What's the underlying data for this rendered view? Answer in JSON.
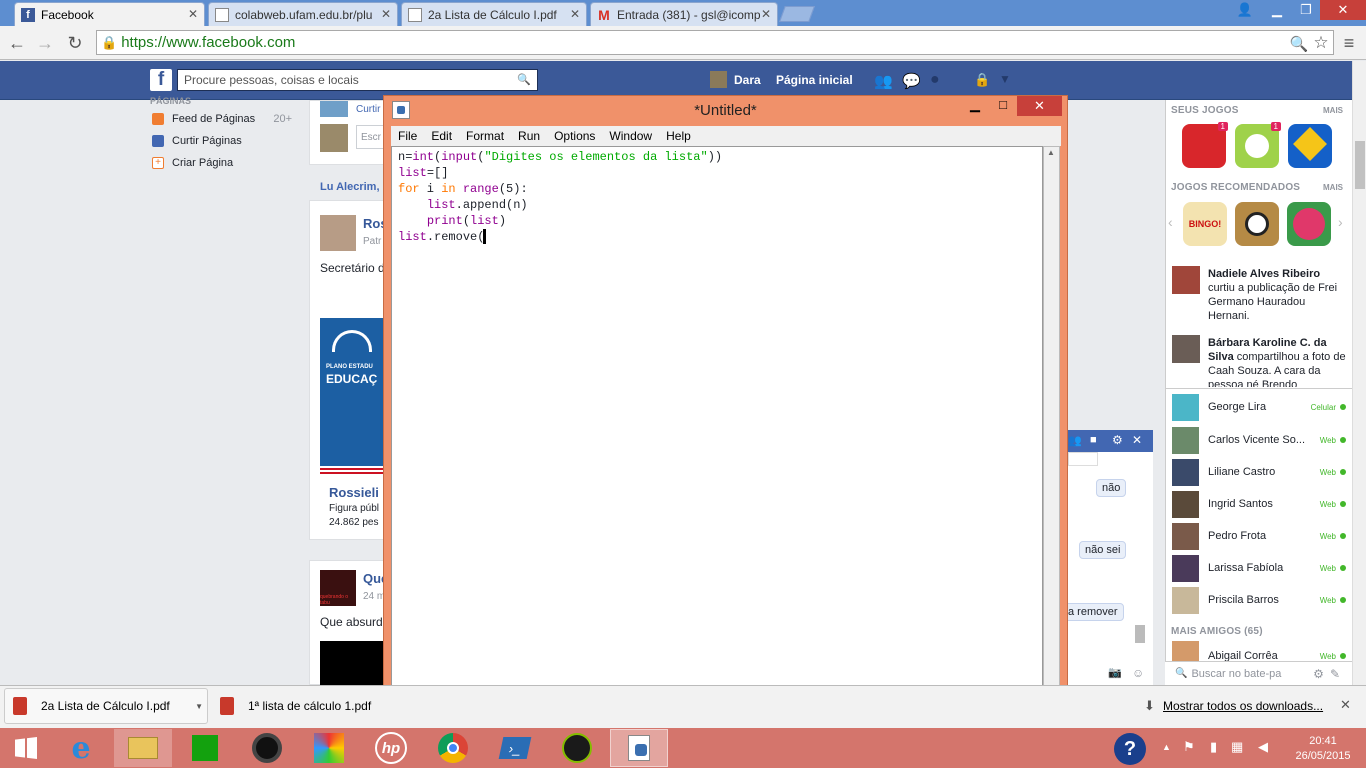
{
  "browser": {
    "tabs": [
      {
        "label": "Facebook",
        "icon": "facebook-icon"
      },
      {
        "label": "colabweb.ufam.edu.br/plu",
        "icon": "page-icon"
      },
      {
        "label": "2a Lista de Cálculo I.pdf",
        "icon": "page-icon"
      },
      {
        "label": "Entrada (381) - gsl@icomp",
        "icon": "gmail-icon"
      }
    ],
    "url": "https://www.facebook.com"
  },
  "facebook": {
    "search_placeholder": "Procure pessoas, coisas e locais",
    "user_name": "Dara",
    "home_label": "Página inicial",
    "left_nav": {
      "section": "PÁGINAS",
      "items": [
        {
          "label": "Feed de Páginas",
          "count": "20+"
        },
        {
          "label": "Curtir Páginas"
        },
        {
          "label": "Criar Página"
        }
      ]
    },
    "feed": {
      "curtir": "Curtir",
      "escrever": "Escr",
      "post_author_partial": "Lu Alecrim,",
      "post1": {
        "name": "Ros",
        "sub": "Patr",
        "text": "Secretário d",
        "img_text_1": "PLANO ESTADU",
        "img_text_2": "EDUCAÇ",
        "page_name": "Rossieli",
        "page_desc": "Figura públ",
        "page_likes": "24.862 pes"
      },
      "post2": {
        "name": "Que",
        "sub": "24 m",
        "thumb_text": "quebrando o tabu",
        "text": "Que absurd"
      }
    },
    "right": {
      "games_header": "SEUS JOGOS",
      "more": "MAIS",
      "recommended_header": "JOGOS RECOMENDADOS",
      "game_badges": [
        "1",
        "1"
      ],
      "bingo_label": "BINGO!",
      "ticker": [
        {
          "name": "Nadiele Alves Ribeiro",
          "text": "curtiu a publicação de Frei Germano Hauradou Hernani."
        },
        {
          "name": "Bárbara Karoline C. da Silva",
          "text": "compartilhou a foto de Caah Souza. A cara da pessoa né Brendo"
        }
      ],
      "friends": [
        {
          "name": "George Lira",
          "status": "Celular"
        },
        {
          "name": "Carlos Vicente So...",
          "status": "Web"
        },
        {
          "name": "Liliane Castro",
          "status": "Web"
        },
        {
          "name": "Ingrid Santos",
          "status": "Web"
        },
        {
          "name": "Pedro Frota",
          "status": "Web"
        },
        {
          "name": "Larissa Fabíola",
          "status": "Web"
        },
        {
          "name": "Priscila Barros",
          "status": "Web"
        }
      ],
      "more_friends_header": "MAIS AMIGOS (65)",
      "more_friend": {
        "name": "Abigail Corrêa",
        "status": "Web"
      },
      "chat_search_placeholder": "Buscar no bate-pa"
    },
    "chat": {
      "messages": [
        "não",
        "não sei",
        "a remover"
      ]
    }
  },
  "idle": {
    "title": "*Untitled*",
    "menu": [
      "File",
      "Edit",
      "Format",
      "Run",
      "Options",
      "Window",
      "Help"
    ],
    "code": [
      [
        {
          "t": "n",
          "c": "pl"
        },
        {
          "t": "=",
          "c": "pl"
        },
        {
          "t": "int",
          "c": "bi"
        },
        {
          "t": "(",
          "c": "pl"
        },
        {
          "t": "input",
          "c": "bi"
        },
        {
          "t": "(",
          "c": "pl"
        },
        {
          "t": "\"Digites os elementos da lista\"",
          "c": "str"
        },
        {
          "t": "))",
          "c": "pl"
        }
      ],
      [
        {
          "t": "list",
          "c": "bi"
        },
        {
          "t": "=[]",
          "c": "pl"
        }
      ],
      [
        {
          "t": "for",
          "c": "kw"
        },
        {
          "t": " i ",
          "c": "pl"
        },
        {
          "t": "in",
          "c": "kw"
        },
        {
          "t": " ",
          "c": "pl"
        },
        {
          "t": "range",
          "c": "bi"
        },
        {
          "t": "(5):",
          "c": "pl"
        }
      ],
      [
        {
          "t": "    ",
          "c": "pl"
        },
        {
          "t": "list",
          "c": "bi"
        },
        {
          "t": ".append(n)",
          "c": "pl"
        }
      ],
      [
        {
          "t": "    ",
          "c": "pl"
        },
        {
          "t": "print",
          "c": "bi"
        },
        {
          "t": "(",
          "c": "pl"
        },
        {
          "t": "list",
          "c": "bi"
        },
        {
          "t": ")",
          "c": "pl"
        }
      ],
      [
        {
          "t": "list",
          "c": "bi"
        },
        {
          "t": ".remove(",
          "c": "pl"
        }
      ]
    ]
  },
  "downloads": {
    "items": [
      "2a Lista de Cálculo I.pdf",
      "1ª lista de cálculo 1.pdf"
    ],
    "show_all": "Mostrar todos os downloads..."
  },
  "taskbar": {
    "time": "20:41",
    "date": "26/05/2015"
  },
  "colors": {
    "facebook_blue": "#3b5998",
    "idle_frame": "#f0916a",
    "taskbar": "#d4756c",
    "online": "#42b72a"
  }
}
